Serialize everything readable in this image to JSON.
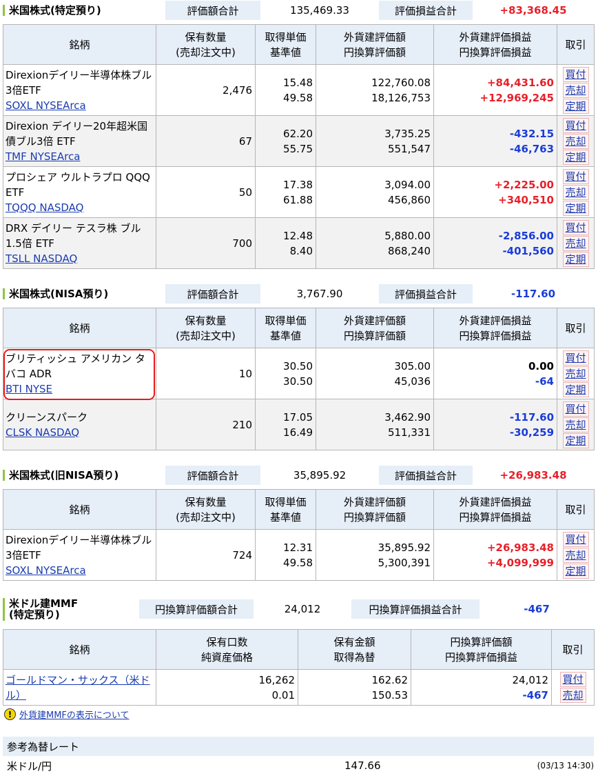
{
  "cols": {
    "name": "銘柄",
    "qty1": "保有数量",
    "qty2": "(売却注文中)",
    "cost1": "取得単価",
    "cost2": "基準値",
    "val1": "外貨建評価額",
    "val2": "円換算評価額",
    "pl1": "外貨建評価損益",
    "pl2": "円換算評価損益",
    "act": "取引"
  },
  "actions": {
    "buy": "買付",
    "sell": "売却",
    "reg": "定期"
  },
  "sec1": {
    "title": "米国株式(特定預り)",
    "total_label": "評価額合計",
    "total": "135,469.33",
    "pl_label": "評価損益合計",
    "pl": "+83,368.45",
    "rows": [
      {
        "name": "Direxionデイリー半導体株ブル3倍ETF",
        "ticker": "SOXL NYSEArca",
        "qty": "2,476",
        "cost": "15.48",
        "base": "49.58",
        "fval": "122,760.08",
        "jval": "18,126,753",
        "fpl": "+84,431.60",
        "jpl": "+12,969,245"
      },
      {
        "name": "Direxion デイリー20年超米国債ブル3倍 ETF",
        "ticker": "TMF NYSEArca",
        "qty": "67",
        "cost": "62.20",
        "base": "55.75",
        "fval": "3,735.25",
        "jval": "551,547",
        "fpl": "-432.15",
        "jpl": "-46,763"
      },
      {
        "name": "プロシェア ウルトラプロ QQQ ETF",
        "ticker": "TQQQ NASDAQ",
        "qty": "50",
        "cost": "17.38",
        "base": "61.88",
        "fval": "3,094.00",
        "jval": "456,860",
        "fpl": "+2,225.00",
        "jpl": "+340,510"
      },
      {
        "name": "DRX デイリー テスラ株 ブル1.5倍 ETF",
        "ticker": "TSLL NASDAQ",
        "qty": "700",
        "cost": "12.48",
        "base": "8.40",
        "fval": "5,880.00",
        "jval": "868,240",
        "fpl": "-2,856.00",
        "jpl": "-401,560"
      }
    ]
  },
  "sec2": {
    "title": "米国株式(NISA預り)",
    "total_label": "評価額合計",
    "total": "3,767.90",
    "pl_label": "評価損益合計",
    "pl": "-117.60",
    "rows": [
      {
        "name": "ブリティッシュ アメリカン タバコ ADR",
        "ticker": "BTI NYSE",
        "qty": "10",
        "cost": "30.50",
        "base": "30.50",
        "fval": "305.00",
        "jval": "45,036",
        "fpl": "0.00",
        "jpl": "-64"
      },
      {
        "name": "クリーンスパーク",
        "ticker": "CLSK NASDAQ",
        "qty": "210",
        "cost": "17.05",
        "base": "16.49",
        "fval": "3,462.90",
        "jval": "511,331",
        "fpl": "-117.60",
        "jpl": "-30,259"
      }
    ]
  },
  "sec3": {
    "title": "米国株式(旧NISA預り)",
    "total_label": "評価額合計",
    "total": "35,895.92",
    "pl_label": "評価損益合計",
    "pl": "+26,983.48",
    "rows": [
      {
        "name": "Direxionデイリー半導体株ブル3倍ETF",
        "ticker": "SOXL NYSEArca",
        "qty": "724",
        "cost": "12.31",
        "base": "49.58",
        "fval": "35,895.92",
        "jval": "5,300,391",
        "fpl": "+26,983.48",
        "jpl": "+4,099,999"
      }
    ]
  },
  "mmf": {
    "title1": "米ドル建MMF",
    "title2": "(特定預り)",
    "total_label": "円換算評価額合計",
    "total": "24,012",
    "pl_label": "円換算評価損益合計",
    "pl": "-467",
    "cols": {
      "name": "銘柄",
      "a1": "保有口数",
      "a2": "純資産価格",
      "b1": "保有金額",
      "b2": "取得為替",
      "c1": "円換算評価額",
      "c2": "円換算評価損益",
      "act": "取引"
    },
    "row": {
      "name": "ゴールドマン・サックス（米ドル）",
      "units": "16,262",
      "nav": "0.01",
      "amount": "162.62",
      "fx": "150.53",
      "jval": "24,012",
      "jpl": "-467"
    }
  },
  "note": {
    "icon": "!",
    "link": "外貨建MMFの表示について"
  },
  "fx": {
    "header": "参考為替レート",
    "pair": "米ドル/円",
    "rate": "147.66",
    "time": "(03/13 14:30)"
  }
}
